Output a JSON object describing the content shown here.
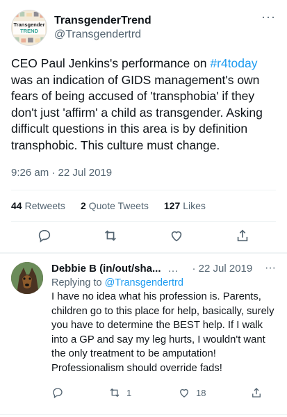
{
  "tweet": {
    "author_name": "TransgenderTrend",
    "handle": "@Transgendertrd",
    "avatar_text_top": "Transgender",
    "avatar_text_bottom": "TREND",
    "more": "···",
    "text_before": "CEO Paul Jenkins's performance on ",
    "hashtag": "#r4today",
    "text_after": " was an indication of GIDS management's own fears of being accused of 'transphobia' if they don't just 'affirm' a child as transgender. Asking difficult questions in this area is by definition transphobic. This culture must change.",
    "timestamp": "9:26 am · 22 Jul 2019"
  },
  "stats": {
    "retweets_count": "44",
    "retweets_label": "Retweets",
    "quotes_count": "2",
    "quotes_label": "Quote Tweets",
    "likes_count": "127",
    "likes_label": "Likes"
  },
  "reply": {
    "author_name": "Debbie B (in/out/sha...",
    "ellipsis": "…",
    "date": "· 22 Jul 2019",
    "more": "···",
    "replying_prefix": "Replying to ",
    "replying_handle": "@Transgendertrd",
    "text": "I have no idea what his profession is. Parents, children go to this place for help, basically, surely you have to determine the BEST help.  If I walk into a GP and say my leg hurts, I wouldn't want the only treatment to be amputation! Professionalism should override fads!",
    "retweets": "1",
    "likes": "18"
  },
  "colors": {
    "accent": "#1d9bf0",
    "secondary_text": "#536471"
  }
}
